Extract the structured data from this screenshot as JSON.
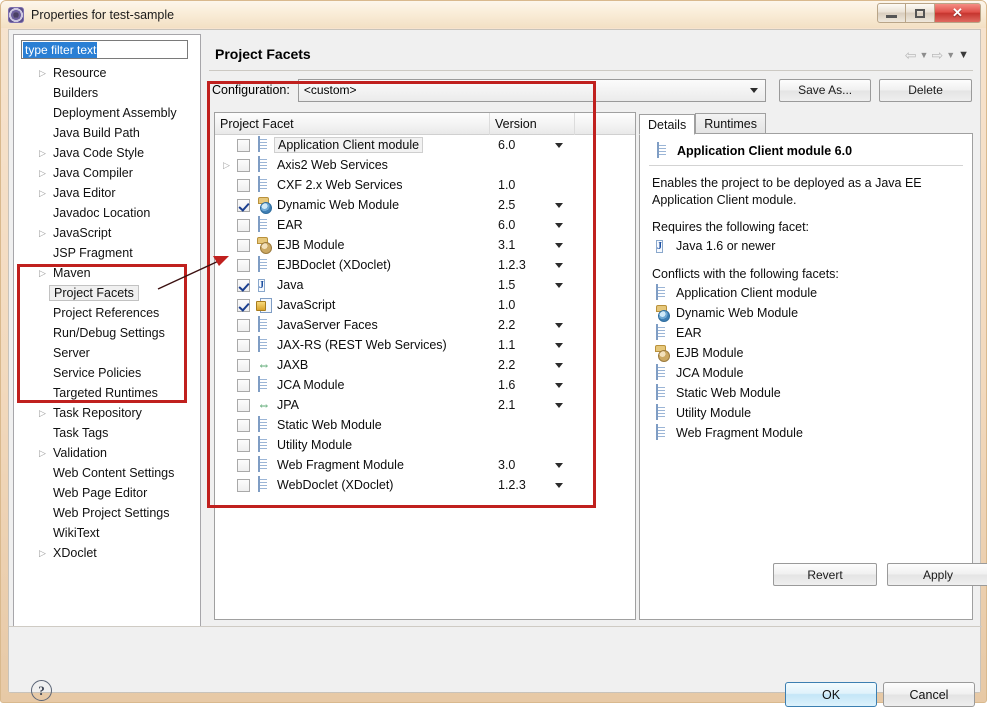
{
  "window": {
    "title": "Properties for test-sample",
    "icon": "properties-icon",
    "minimize_label": "",
    "maximize_label": "",
    "close_label": "✕"
  },
  "sidebar": {
    "filter_placeholder": "type filter text",
    "filter_value": "type filter text",
    "items": [
      {
        "label": "Resource",
        "expandable": true,
        "selected": false,
        "highlighted": false
      },
      {
        "label": "Builders",
        "expandable": false,
        "selected": false,
        "highlighted": false
      },
      {
        "label": "Deployment Assembly",
        "expandable": false,
        "selected": false,
        "highlighted": false
      },
      {
        "label": "Java Build Path",
        "expandable": false,
        "selected": false,
        "highlighted": false
      },
      {
        "label": "Java Code Style",
        "expandable": true,
        "selected": false,
        "highlighted": false
      },
      {
        "label": "Java Compiler",
        "expandable": true,
        "selected": false,
        "highlighted": false
      },
      {
        "label": "Java Editor",
        "expandable": true,
        "selected": false,
        "highlighted": false
      },
      {
        "label": "Javadoc Location",
        "expandable": false,
        "selected": false,
        "highlighted": false
      },
      {
        "label": "JavaScript",
        "expandable": true,
        "selected": false,
        "highlighted": false
      },
      {
        "label": "JSP Fragment",
        "expandable": false,
        "selected": false,
        "highlighted": false
      },
      {
        "label": "Maven",
        "expandable": true,
        "selected": false,
        "highlighted": true
      },
      {
        "label": "Project Facets",
        "expandable": false,
        "selected": true,
        "highlighted": true
      },
      {
        "label": "Project References",
        "expandable": false,
        "selected": false,
        "highlighted": true
      },
      {
        "label": "Run/Debug Settings",
        "expandable": false,
        "selected": false,
        "highlighted": true
      },
      {
        "label": "Server",
        "expandable": false,
        "selected": false,
        "highlighted": true
      },
      {
        "label": "Service Policies",
        "expandable": false,
        "selected": false,
        "highlighted": true
      },
      {
        "label": "Targeted Runtimes",
        "expandable": false,
        "selected": false,
        "highlighted": true
      },
      {
        "label": "Task Repository",
        "expandable": true,
        "selected": false,
        "highlighted": false
      },
      {
        "label": "Task Tags",
        "expandable": false,
        "selected": false,
        "highlighted": false
      },
      {
        "label": "Validation",
        "expandable": true,
        "selected": false,
        "highlighted": false
      },
      {
        "label": "Web Content Settings",
        "expandable": false,
        "selected": false,
        "highlighted": false
      },
      {
        "label": "Web Page Editor",
        "expandable": false,
        "selected": false,
        "highlighted": false
      },
      {
        "label": "Web Project Settings",
        "expandable": false,
        "selected": false,
        "highlighted": false
      },
      {
        "label": "WikiText",
        "expandable": false,
        "selected": false,
        "highlighted": false
      },
      {
        "label": "XDoclet",
        "expandable": true,
        "selected": false,
        "highlighted": false
      }
    ]
  },
  "page": {
    "title": "Project Facets",
    "config_label": "Configuration:",
    "config_value": "<custom>",
    "save_as_label": "Save As...",
    "delete_label": "Delete",
    "revert_label": "Revert",
    "apply_label": "Apply"
  },
  "facet_table": {
    "col_facet": "Project Facet",
    "col_version": "Version",
    "rows": [
      {
        "name": "Application Client module",
        "version": "6.0",
        "checked": false,
        "icon": "doc-icon",
        "expandable": false,
        "has_dropdown": true,
        "selected": true
      },
      {
        "name": "Axis2 Web Services",
        "version": "",
        "checked": false,
        "icon": "doc-icon",
        "expandable": true,
        "has_dropdown": false,
        "selected": false
      },
      {
        "name": "CXF 2.x Web Services",
        "version": "1.0",
        "checked": false,
        "icon": "doc-icon",
        "expandable": false,
        "has_dropdown": false,
        "selected": false
      },
      {
        "name": "Dynamic Web Module",
        "version": "2.5",
        "checked": true,
        "icon": "web-icon",
        "expandable": false,
        "has_dropdown": true,
        "selected": false
      },
      {
        "name": "EAR",
        "version": "6.0",
        "checked": false,
        "icon": "doc-icon",
        "expandable": false,
        "has_dropdown": true,
        "selected": false
      },
      {
        "name": "EJB Module",
        "version": "3.1",
        "checked": false,
        "icon": "ejb-icon",
        "expandable": false,
        "has_dropdown": true,
        "selected": false
      },
      {
        "name": "EJBDoclet (XDoclet)",
        "version": "1.2.3",
        "checked": false,
        "icon": "doc-icon",
        "expandable": false,
        "has_dropdown": true,
        "selected": false
      },
      {
        "name": "Java",
        "version": "1.5",
        "checked": true,
        "icon": "java-icon",
        "expandable": false,
        "has_dropdown": true,
        "selected": false
      },
      {
        "name": "JavaScript",
        "version": "1.0",
        "checked": true,
        "icon": "js-icon",
        "expandable": false,
        "has_dropdown": false,
        "selected": false
      },
      {
        "name": "JavaServer Faces",
        "version": "2.2",
        "checked": false,
        "icon": "doc-icon",
        "expandable": false,
        "has_dropdown": true,
        "selected": false
      },
      {
        "name": "JAX-RS (REST Web Services)",
        "version": "1.1",
        "checked": false,
        "icon": "doc-icon",
        "expandable": false,
        "has_dropdown": true,
        "selected": false
      },
      {
        "name": "JAXB",
        "version": "2.2",
        "checked": false,
        "icon": "arrows-icon",
        "expandable": false,
        "has_dropdown": true,
        "selected": false
      },
      {
        "name": "JCA Module",
        "version": "1.6",
        "checked": false,
        "icon": "doc-icon",
        "expandable": false,
        "has_dropdown": true,
        "selected": false
      },
      {
        "name": "JPA",
        "version": "2.1",
        "checked": false,
        "icon": "arrows-icon",
        "expandable": false,
        "has_dropdown": true,
        "selected": false
      },
      {
        "name": "Static Web Module",
        "version": "",
        "checked": false,
        "icon": "doc-icon",
        "expandable": false,
        "has_dropdown": false,
        "selected": false
      },
      {
        "name": "Utility Module",
        "version": "",
        "checked": false,
        "icon": "doc-icon",
        "expandable": false,
        "has_dropdown": false,
        "selected": false
      },
      {
        "name": "Web Fragment Module",
        "version": "3.0",
        "checked": false,
        "icon": "doc-icon",
        "expandable": false,
        "has_dropdown": true,
        "selected": false
      },
      {
        "name": "WebDoclet (XDoclet)",
        "version": "1.2.3",
        "checked": false,
        "icon": "doc-icon",
        "expandable": false,
        "has_dropdown": true,
        "selected": false
      }
    ]
  },
  "details": {
    "tabs": [
      {
        "label": "Details",
        "active": true
      },
      {
        "label": "Runtimes",
        "active": false
      }
    ],
    "heading": "Application Client module 6.0",
    "heading_icon": "doc-icon",
    "description": "Enables the project to be deployed as a Java EE Application Client module.",
    "requires_label": "Requires the following facet:",
    "requires": [
      {
        "label": "Java 1.6 or newer",
        "icon": "java-icon"
      }
    ],
    "conflicts_label": "Conflicts with the following facets:",
    "conflicts": [
      {
        "label": "Application Client module",
        "icon": "doc-icon"
      },
      {
        "label": "Dynamic Web Module",
        "icon": "web-icon"
      },
      {
        "label": "EAR",
        "icon": "doc-icon"
      },
      {
        "label": "EJB Module",
        "icon": "ejb-icon"
      },
      {
        "label": "JCA Module",
        "icon": "doc-icon"
      },
      {
        "label": "Static Web Module",
        "icon": "doc-icon"
      },
      {
        "label": "Utility Module",
        "icon": "doc-icon"
      },
      {
        "label": "Web Fragment Module",
        "icon": "doc-icon"
      }
    ]
  },
  "footer": {
    "help_label": "?",
    "ok_label": "OK",
    "cancel_label": "Cancel"
  },
  "annotations": {
    "highlight_color": "#c0201e"
  }
}
